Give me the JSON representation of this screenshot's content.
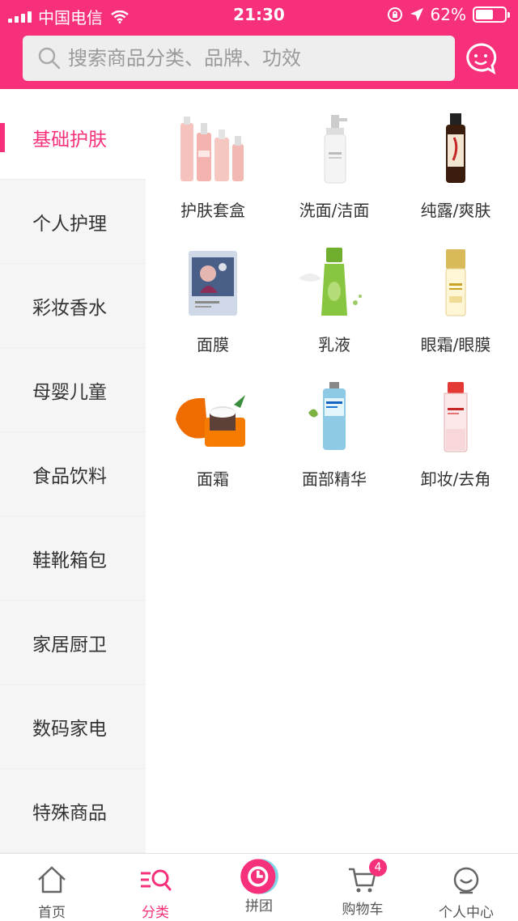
{
  "status_bar": {
    "carrier": "中国电信",
    "time": "21:30",
    "battery": "62%",
    "battery_level": 0.62
  },
  "search": {
    "placeholder": "搜索商品分类、品牌、功效"
  },
  "sidebar": {
    "items": [
      {
        "label": "基础护肤",
        "active": true
      },
      {
        "label": "个人护理"
      },
      {
        "label": "彩妆香水"
      },
      {
        "label": "母婴儿童"
      },
      {
        "label": "食品饮料"
      },
      {
        "label": "鞋靴箱包"
      },
      {
        "label": "家居厨卫"
      },
      {
        "label": "数码家电"
      },
      {
        "label": "特殊商品"
      }
    ]
  },
  "categories": [
    {
      "label": "护肤套盒",
      "icon": "skincare-set-image"
    },
    {
      "label": "洗面/洁面",
      "icon": "cleanser-image"
    },
    {
      "label": "纯露/爽肤",
      "icon": "toner-image"
    },
    {
      "label": "面膜",
      "icon": "face-mask-image"
    },
    {
      "label": "乳液",
      "icon": "lotion-image"
    },
    {
      "label": "眼霜/眼膜",
      "icon": "eye-cream-image"
    },
    {
      "label": "面霜",
      "icon": "face-cream-image"
    },
    {
      "label": "面部精华",
      "icon": "serum-image"
    },
    {
      "label": "卸妆/去角",
      "icon": "makeup-remover-image"
    }
  ],
  "tabbar": {
    "items": [
      {
        "label": "首页",
        "icon": "home-icon"
      },
      {
        "label": "分类",
        "icon": "category-icon",
        "active": true
      },
      {
        "label": "拼团",
        "icon": "group-buy-icon"
      },
      {
        "label": "购物车",
        "icon": "cart-icon",
        "badge": "4"
      },
      {
        "label": "个人中心",
        "icon": "profile-icon"
      }
    ]
  },
  "colors": {
    "accent": "#f7307c",
    "sidebar_bg": "#f5f5f5"
  }
}
